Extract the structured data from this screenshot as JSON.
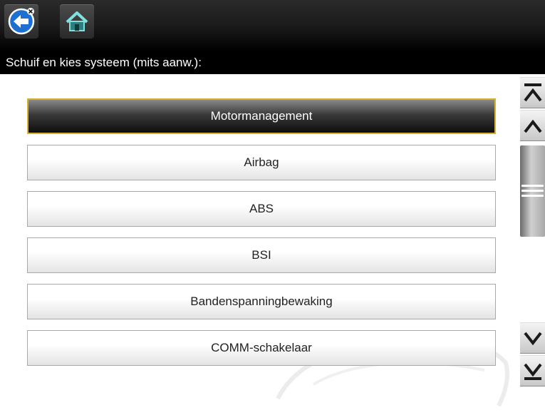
{
  "toolbar": {
    "back_icon": "back-arrow-icon",
    "home_icon": "home-icon"
  },
  "title_bar": {
    "text": "Schuif en kies systeem (mits aanw.):"
  },
  "systems": {
    "items": [
      {
        "label": "Motormanagement",
        "selected": true
      },
      {
        "label": "Airbag",
        "selected": false
      },
      {
        "label": "ABS",
        "selected": false
      },
      {
        "label": "BSI",
        "selected": false
      },
      {
        "label": "Bandenspanningbewaking",
        "selected": false
      },
      {
        "label": "COMM-schakelaar",
        "selected": false
      }
    ]
  },
  "scrollbar": {
    "buttons": [
      "scroll-top-icon",
      "scroll-up-icon",
      "scroll-down-icon",
      "scroll-bottom-icon"
    ]
  },
  "colors": {
    "selection_border": "#d6b030",
    "toolbar_bg": "#1b1b1b",
    "back_button": "#1d6fd1",
    "home_button": "#2d7f7f"
  }
}
